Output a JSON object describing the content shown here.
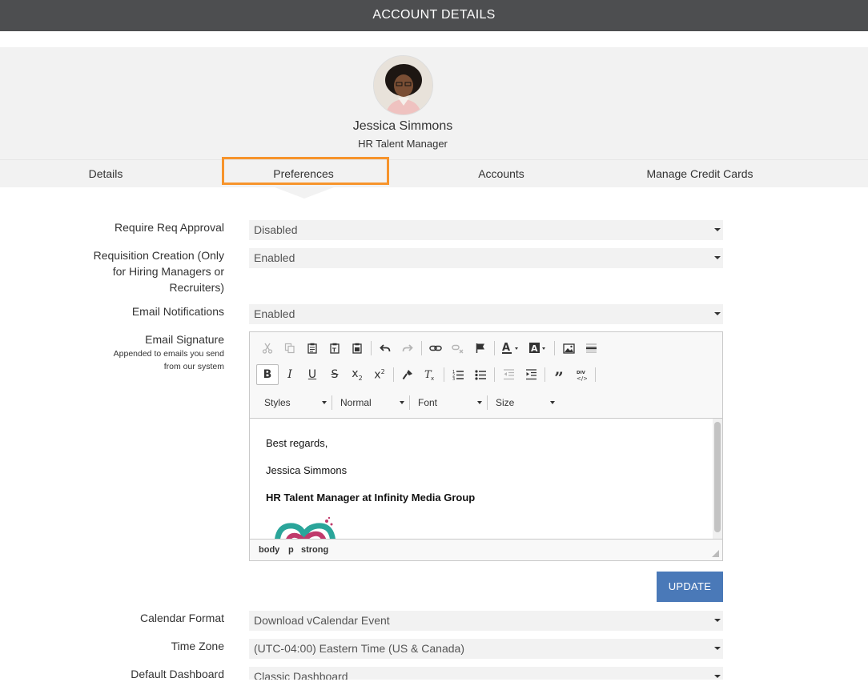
{
  "header": {
    "title": "ACCOUNT DETAILS"
  },
  "profile": {
    "name": "Jessica Simmons",
    "role": "HR Talent Manager"
  },
  "tabs": [
    {
      "label": "Details"
    },
    {
      "label": "Preferences"
    },
    {
      "label": "Accounts"
    },
    {
      "label": "Manage Credit Cards"
    }
  ],
  "colors": {
    "active_tab_outline": "#f7942c",
    "update_button": "#4a79b8",
    "topbar": "#4d4e50"
  },
  "fields": {
    "req_approval": {
      "label": "Require Req Approval",
      "value": "Disabled"
    },
    "req_creation": {
      "label_lines": [
        "Requisition Creation (Only",
        "for Hiring Managers or",
        "Recruiters)"
      ],
      "value": "Enabled"
    },
    "email_notifications": {
      "label": "Email Notifications",
      "value": "Enabled"
    },
    "email_signature": {
      "label": "Email Signature",
      "sublabel_lines": [
        "Appended to emails you send",
        "from our system"
      ]
    },
    "calendar_format": {
      "label": "Calendar Format",
      "value": "Download vCalendar Event"
    },
    "time_zone": {
      "label": "Time Zone",
      "value": "(UTC-04:00) Eastern Time (US & Canada)"
    },
    "default_dashboard": {
      "label": "Default Dashboard",
      "value": "Classic Dashboard"
    }
  },
  "editor": {
    "toolbar_row1": [
      "cut-icon",
      "copy-icon",
      "paste-icon",
      "paste-text-icon",
      "paste-word-icon",
      "undo-icon",
      "redo-icon",
      "link-icon",
      "unlink-icon",
      "anchor-icon",
      "text-color-icon",
      "background-color-icon",
      "image-icon",
      "horizontal-rule-icon"
    ],
    "toolbar_row2": [
      "bold-icon",
      "italic-icon",
      "underline-icon",
      "strikethrough-icon",
      "subscript-icon",
      "superscript-icon",
      "copy-formatting-icon",
      "remove-format-icon",
      "numbered-list-icon",
      "bulleted-list-icon",
      "outdent-icon",
      "indent-icon",
      "blockquote-icon",
      "div-container-icon"
    ],
    "combos": {
      "styles": "Styles",
      "format": "Normal",
      "font": "Font",
      "size": "Size"
    },
    "content": {
      "line1": "Best regards,",
      "line2": "Jessica Simmons",
      "line3": "HR Talent Manager at Infinity Media Group"
    },
    "path": [
      "body",
      "p",
      "strong"
    ]
  },
  "buttons": {
    "update": "UPDATE"
  }
}
